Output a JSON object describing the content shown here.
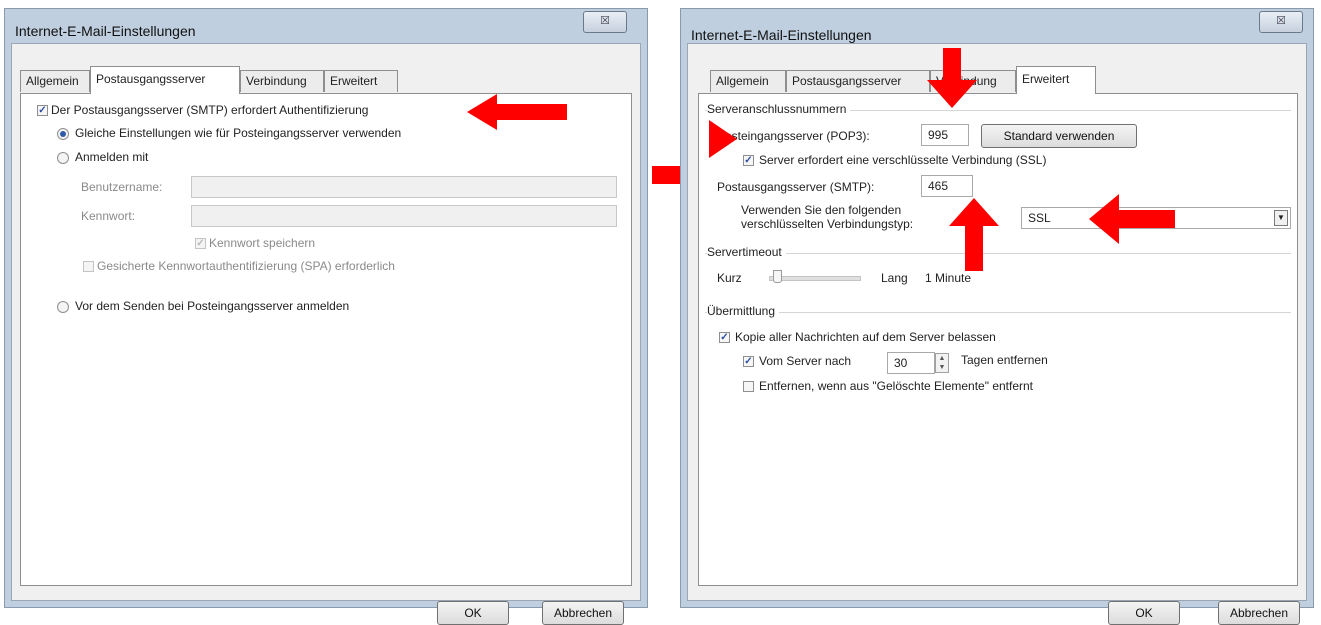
{
  "colors": {
    "annotation_arrow": "#ff0000",
    "dialog_frame": "#bfcfe0"
  },
  "left_dialog": {
    "title": "Internet-E-Mail-Einstellungen",
    "close_icon": "close-icon",
    "close_symbol": "☒",
    "tabs": [
      "Allgemein",
      "Postausgangsserver",
      "Verbindung",
      "Erweitert"
    ],
    "active_tab": "Postausgangsserver",
    "smtp_auth_label": "Der Postausgangsserver (SMTP) erfordert Authentifizierung",
    "smtp_auth_checked": true,
    "same_settings_label": "Gleiche Einstellungen wie für Posteingangsserver verwenden",
    "login_with_label": "Anmelden mit",
    "username_label": "Benutzername:",
    "username_value": "",
    "password_label": "Kennwort:",
    "password_value": "",
    "save_password_label": "Kennwort speichern",
    "spa_label": "Gesicherte Kennwortauthentifizierung (SPA) erforderlich",
    "login_incoming_label": "Vor dem Senden bei Posteingangsserver anmelden",
    "ok_label": "OK",
    "cancel_label": "Abbrechen"
  },
  "right_dialog": {
    "title": "Internet-E-Mail-Einstellungen",
    "close_symbol": "☒",
    "tabs": [
      "Allgemein",
      "Postausgangsserver",
      "Verbindung",
      "Erweitert"
    ],
    "active_tab": "Erweitert",
    "server_ports_group": "Serveranschlussnummern",
    "pop3_label": "Posteingangsserver (POP3):",
    "pop3_value": "995",
    "default_button": "Standard verwenden",
    "ssl_required_label": "Server erfordert eine verschlüsselte Verbindung (SSL)",
    "smtp_label": "Postausgangsserver (SMTP):",
    "smtp_value": "465",
    "encryption_label_line1": "Verwenden Sie den folgenden",
    "encryption_label_line2": "verschlüsselten Verbindungstyp:",
    "encryption_value": "SSL",
    "timeout_group": "Servertimeout",
    "timeout_short": "Kurz",
    "timeout_long": "Lang",
    "timeout_value": "1 Minute",
    "delivery_group": "Übermittlung",
    "keep_copy_label": "Kopie aller Nachrichten auf dem Server belassen",
    "remove_after_label": "Vom Server nach",
    "remove_after_days": "30",
    "days_label": "Tagen entfernen",
    "remove_deleted_label": "Entfernen, wenn aus \"Gelöschte Elemente\" entfernt",
    "ok_label": "OK",
    "cancel_label": "Abbrechen"
  }
}
